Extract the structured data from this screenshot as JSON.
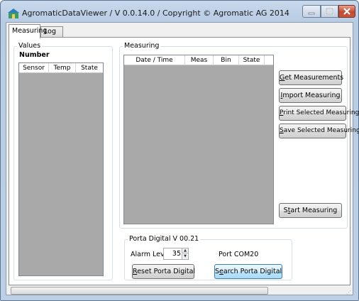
{
  "window": {
    "title": "AgromaticDataViewer / V 0.0.14.0 / Copyright © Agromatic AG 2014"
  },
  "tabs": [
    {
      "label": "Measuring",
      "active": true
    },
    {
      "label": "Log",
      "active": false
    }
  ],
  "values": {
    "group_label": "Values",
    "number_label": "Number",
    "columns": [
      "Sensor",
      "Temp",
      "State"
    ]
  },
  "measuring": {
    "group_label": "Measuring",
    "columns": [
      "Date / Time",
      "Meas",
      "Bin",
      "State"
    ],
    "buttons": {
      "get_accel": "G",
      "get_rest": "et Measurements",
      "import_accel": "I",
      "import_rest": "mport Measuring",
      "print_accel": "P",
      "print_rest": "rint Selected Measuring",
      "save_accel": "S",
      "save_rest": "ave Selected Measuring",
      "start_pre": "S",
      "start_accel": "t",
      "start_rest": "art Measuring"
    }
  },
  "porta": {
    "group_label": "Porta Digital V 00.21",
    "alarm_label": "Alarm Level",
    "alarm_value": "35",
    "port_label": "Port COM20",
    "reset_accel": "R",
    "reset_rest": "eset Porta Digital",
    "search_pre": "S",
    "search_accel": "e",
    "search_rest": "arch Porta Digital"
  },
  "colors": {
    "grid_background": "#a9a9a9",
    "focused_button": "#bee6fd",
    "close_button": "#c34a32"
  }
}
